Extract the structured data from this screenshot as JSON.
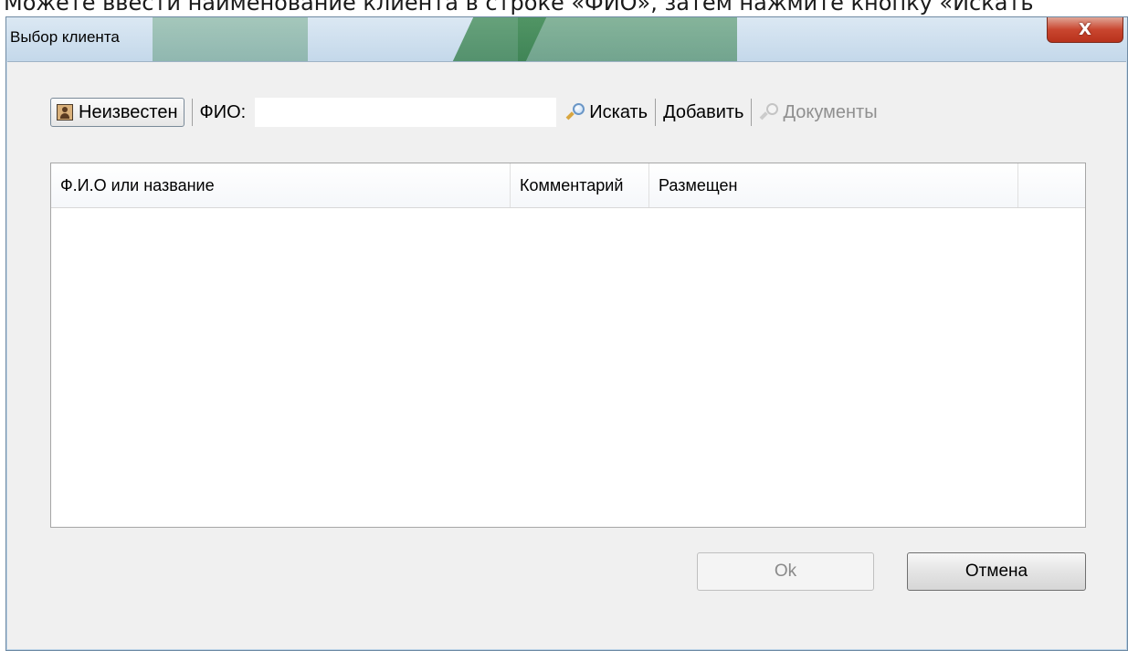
{
  "instruction_text": "Можете ввести наименование клиента в строке «ФИО», затем нажмите кнопку «Искать",
  "window": {
    "title": "Выбор клиента",
    "close_label": "X"
  },
  "toolbar": {
    "unknown_label": "Неизвестен",
    "fio_label": "ФИО:",
    "fio_value": "",
    "search_label": "Искать",
    "add_label": "Добавить",
    "documents_label": "Документы"
  },
  "table": {
    "columns": [
      "Ф.И.О или название",
      "Комментарий",
      "Размещен",
      ""
    ],
    "rows": []
  },
  "footer": {
    "ok_label": "Ok",
    "cancel_label": "Отмена"
  },
  "icons": {
    "person": "person-icon",
    "search": "magnifier-icon",
    "documents": "magnifier-icon"
  }
}
